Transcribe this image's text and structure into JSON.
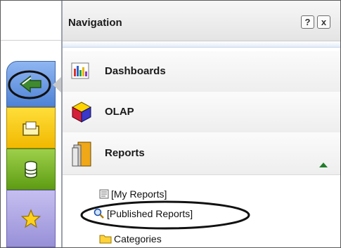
{
  "panel": {
    "title": "Navigation",
    "help_label": "?",
    "close_label": "x"
  },
  "nav_rows": [
    {
      "label": "Dashboards",
      "icon": "bar-chart-icon"
    },
    {
      "label": "OLAP",
      "icon": "olap-cube-icon"
    },
    {
      "label": "Reports",
      "icon": "reports-book-icon",
      "expanded": true
    }
  ],
  "reports_tree": [
    {
      "label": "[My Reports]",
      "icon": "document-icon"
    },
    {
      "label": "[Published Reports]",
      "icon": "magnifier-icon"
    },
    {
      "label": "Categories",
      "icon": "folder-icon"
    }
  ],
  "side_tabs": [
    {
      "name": "navigation",
      "icon": "navigation-arrow-icon",
      "color": "#5b8fdf",
      "highlighted": true
    },
    {
      "name": "files",
      "icon": "folder-tab-icon",
      "color": "#f6c800"
    },
    {
      "name": "data",
      "icon": "database-icon",
      "color": "#74b022"
    },
    {
      "name": "favorites",
      "icon": "star-icon",
      "color": "#aba4e2"
    }
  ],
  "colors": {
    "expand_arrow": "#1f7d2a",
    "annotation_circle": "#111111"
  }
}
